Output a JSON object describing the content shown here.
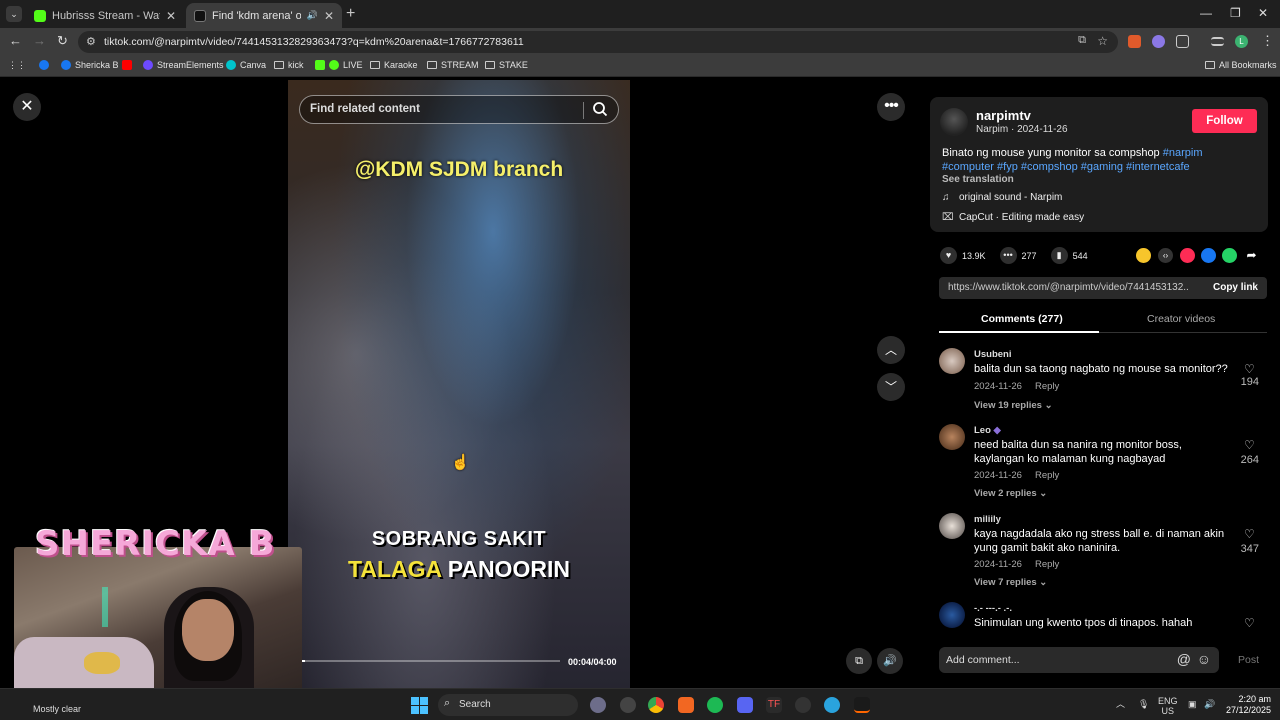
{
  "browser": {
    "tabs": [
      {
        "title": "Hubrisss Stream - Watch Live o",
        "close": "✕",
        "active": false
      },
      {
        "title": "Find 'kdm arena' on TikToi",
        "close": "✕",
        "active": true
      }
    ],
    "new_tab": "+",
    "url": "tiktok.com/@narpimtv/video/7441453132829363473?q=kdm%20arena&t=1766772783611",
    "bookmarks": [
      "Shericka B",
      "StreamElements",
      "Canva",
      "kick",
      "LIVE",
      "Karaoke",
      "STREAM",
      "STAKE"
    ],
    "all_bookmarks": "All Bookmarks",
    "profile_letter": "L"
  },
  "video": {
    "caption_top": "@KDM SJDM branch",
    "caption_line1": "SOBRANG SAKIT",
    "caption_highlight": "TALAGA",
    "caption_rest": "PANOORIN",
    "time": "00:04/04:00",
    "progress": 0.02
  },
  "search": {
    "placeholder": "Find related content"
  },
  "overlay": {
    "streamer_name": "SHERICKA B"
  },
  "post": {
    "username": "narpimtv",
    "subline": "Narpim · 2024-11-26",
    "follow_label": "Follow",
    "description_text": "Binato ng mouse yung monitor sa compshop ",
    "hashtags_line1": "#narpim",
    "hashtags_line2": "#computer #fyp #compshop #gaming #internetcafe",
    "see_translation": "See translation",
    "sound": "original sound - Narpim",
    "capcut": "CapCut · Editing made easy",
    "likes": "13.9K",
    "comments": "277",
    "saves": "544",
    "link": "https://www.tiktok.com/@narpimtv/video/7441453132...",
    "copy_link": "Copy link"
  },
  "panel_tabs": {
    "comments": "Comments (277)",
    "creator": "Creator videos"
  },
  "comments": [
    {
      "name": "Usubeni",
      "text": "balita dun sa taong nagbato ng mouse sa monitor??",
      "date": "2024-11-26",
      "reply": "Reply",
      "likes": "194",
      "view": "View 19 replies ⌄"
    },
    {
      "name": "Leo",
      "text": "need balita dun sa nanira ng monitor boss, kaylangan ko malaman kung nagbayad",
      "date": "2024-11-26",
      "reply": "Reply",
      "likes": "264",
      "view": "View 2 replies ⌄"
    },
    {
      "name": "miliily",
      "text": "kaya nagdadala ako ng stress ball e. di naman akin yung gamit bakit ako naninira.",
      "date": "2024-11-26",
      "reply": "Reply",
      "likes": "347",
      "view": "View 7 replies ⌄"
    },
    {
      "name": "-.- ---.- .-.",
      "text": "Sinimulan ung kwento tpos di tinapos. hahah",
      "date": "",
      "reply": "",
      "likes": "",
      "view": ""
    }
  ],
  "add_comment": {
    "placeholder": "Add comment...",
    "post_label": "Post"
  },
  "taskbar": {
    "weather": "Mostly clear",
    "search_placeholder": "Search",
    "lang": "ENG",
    "region": "US",
    "time": "2:20 am",
    "date": "27/12/2025"
  },
  "colors": {
    "follow": "#fe2c55",
    "hashtag": "#5aa7ff",
    "accent_tab": "#ffffff"
  }
}
